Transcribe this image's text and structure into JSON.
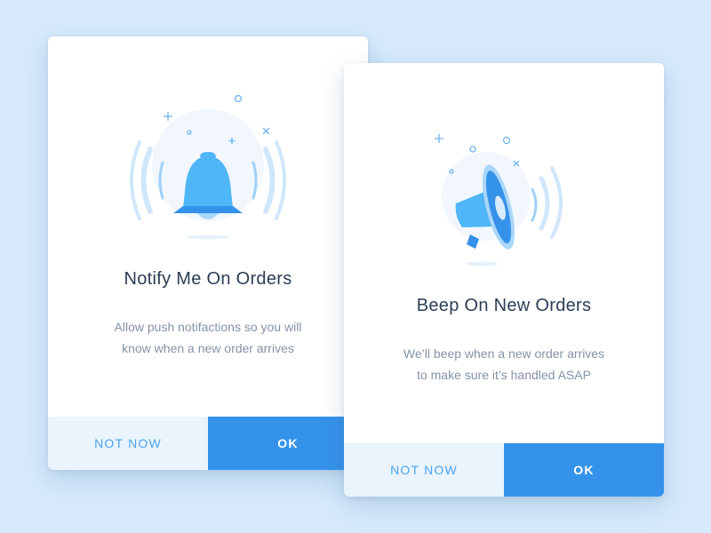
{
  "cards": [
    {
      "title": "Notify Me On Orders",
      "description": "Allow push notifactions so you will know when a new order arrives",
      "secondary_label": "NOT NOW",
      "primary_label": "OK"
    },
    {
      "title": "Beep On New Orders",
      "description": "We’ll beep when a new order arrives to make sure it’s handled ASAP",
      "secondary_label": "NOT NOW",
      "primary_label": "OK"
    }
  ],
  "colors": {
    "background": "#d6eafb",
    "primary": "#3592ea",
    "secondary_bg": "#eaf4fd",
    "secondary_text": "#4aa3f0",
    "title": "#2c3e55",
    "body": "#8593a5"
  },
  "icons": [
    "bell-icon",
    "megaphone-icon"
  ]
}
